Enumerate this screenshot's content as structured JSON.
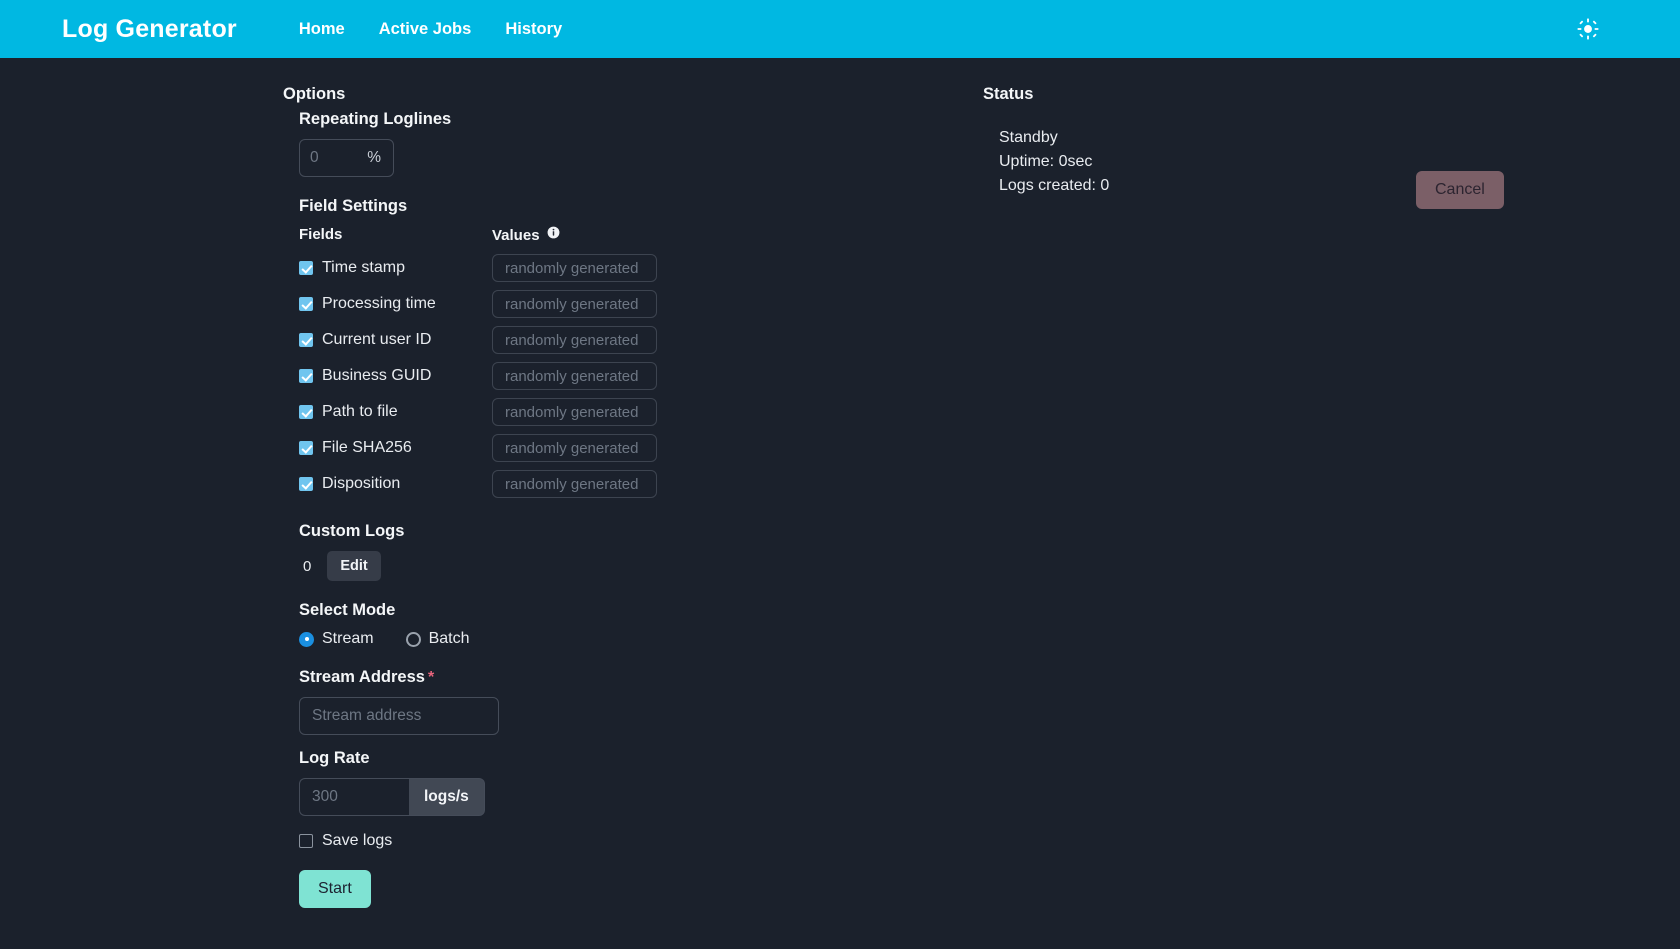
{
  "navbar": {
    "brand": "Log Generator",
    "links": [
      {
        "label": "Home"
      },
      {
        "label": "Active Jobs"
      },
      {
        "label": "History"
      }
    ],
    "theme_icon": "sun-icon",
    "background_color": "#00b8e2"
  },
  "options": {
    "title": "Options",
    "repeating": {
      "label": "Repeating Loglines",
      "placeholder": "0",
      "value": "",
      "unit": "%"
    },
    "field_settings": {
      "title": "Field Settings",
      "columns": {
        "fields": "Fields",
        "values": "Values",
        "values_info_icon": "info-icon"
      },
      "rows": [
        {
          "label": "Time stamp",
          "checked": true,
          "value_placeholder": "randomly generated",
          "value": ""
        },
        {
          "label": "Processing time",
          "checked": true,
          "value_placeholder": "randomly generated",
          "value": ""
        },
        {
          "label": "Current user ID",
          "checked": true,
          "value_placeholder": "randomly generated",
          "value": ""
        },
        {
          "label": "Business GUID",
          "checked": true,
          "value_placeholder": "randomly generated",
          "value": ""
        },
        {
          "label": "Path to file",
          "checked": true,
          "value_placeholder": "randomly generated",
          "value": ""
        },
        {
          "label": "File SHA256",
          "checked": true,
          "value_placeholder": "randomly generated",
          "value": ""
        },
        {
          "label": "Disposition",
          "checked": true,
          "value_placeholder": "randomly generated",
          "value": ""
        }
      ]
    },
    "custom_logs": {
      "title": "Custom Logs",
      "count": "0",
      "edit_label": "Edit"
    },
    "select_mode": {
      "title": "Select Mode",
      "options": [
        {
          "label": "Stream",
          "selected": true
        },
        {
          "label": "Batch",
          "selected": false
        }
      ]
    },
    "stream_address": {
      "label": "Stream Address",
      "required_marker": "*",
      "placeholder": "Stream address",
      "value": ""
    },
    "log_rate": {
      "label": "Log Rate",
      "placeholder": "300",
      "value": "",
      "unit": "logs/s"
    },
    "save_logs": {
      "label": "Save logs",
      "checked": false
    },
    "start_button": "Start"
  },
  "status": {
    "title": "Status",
    "state": "Standby",
    "uptime": "Uptime: 0sec",
    "logs_created": "Logs created: 0",
    "cancel_button": "Cancel"
  },
  "colors": {
    "page_background": "#1b212c",
    "navbar": "#00b8e2",
    "accent_start": "#7fe3d3",
    "cancel_disabled": "#7b5f67",
    "checkbox_checked": "#70c5ef",
    "radio_selected": "#1a8fe0",
    "required_star": "#e8647c"
  }
}
